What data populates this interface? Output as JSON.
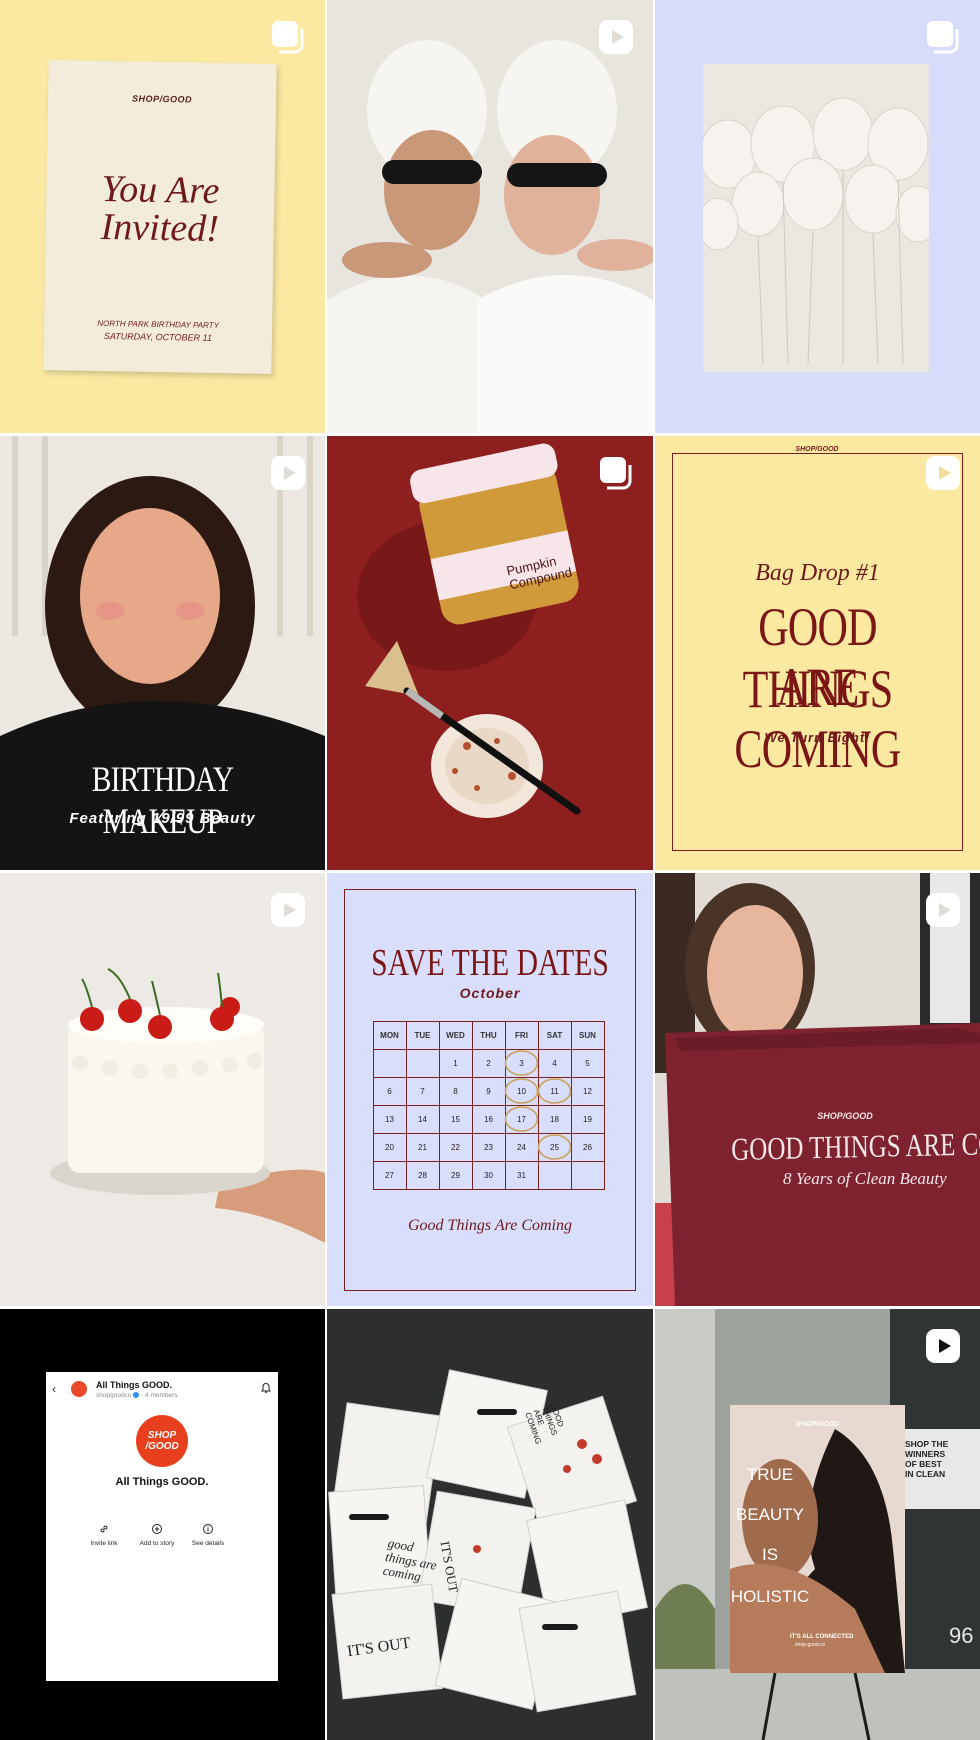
{
  "badges": {
    "carousel": "carousel-icon",
    "reel": "reel-icon"
  },
  "posts": [
    {
      "kind": "invite",
      "brand": "SHOP/GOOD",
      "title_line1": "You Are",
      "title_line2": "Invited!",
      "subtitle_line1": "NORTH PARK BIRTHDAY PARTY",
      "subtitle_line2": "SATURDAY, OCTOBER 11"
    },
    {
      "kind": "photo-towels"
    },
    {
      "kind": "photo-balloons"
    },
    {
      "kind": "birthday-makeup",
      "title": "BIRTHDAY MAKEUP",
      "subtitle": "Featuring 19/99 Beauty"
    },
    {
      "kind": "pumpkin",
      "jar_label_line1": "Pumpkin",
      "jar_label_line2": "Compound",
      "brush_brand": "SHOP/GOOD"
    },
    {
      "kind": "bag-drop",
      "brand": "SHOP/GOOD",
      "script": "Bag Drop #1",
      "line1": "GOOD THINGS",
      "line2": "ARE COMING",
      "footer": "We Turn Eight!"
    },
    {
      "kind": "cake"
    },
    {
      "kind": "calendar",
      "title": "SAVE THE DATES",
      "month": "October",
      "footer": "Good Things Are Coming",
      "days": [
        "MON",
        "TUE",
        "WED",
        "THU",
        "FRI",
        "SAT",
        "SUN"
      ],
      "weeks": [
        [
          "",
          "",
          "1",
          "2",
          "3",
          "4",
          "5"
        ],
        [
          "6",
          "7",
          "8",
          "9",
          "10",
          "11",
          "12"
        ],
        [
          "13",
          "14",
          "15",
          "16",
          "17",
          "18",
          "19"
        ],
        [
          "20",
          "21",
          "22",
          "23",
          "24",
          "25",
          "26"
        ],
        [
          "27",
          "28",
          "29",
          "30",
          "31",
          "",
          ""
        ]
      ],
      "circled": [
        "3",
        "10",
        "11",
        "17",
        "25"
      ]
    },
    {
      "kind": "tote",
      "brand": "SHOP/GOOD",
      "line1": "GOOD THINGS ARE COMI",
      "line2": "8 Years of Clean Beauty"
    },
    {
      "kind": "channel",
      "channel_name": "All Things GOOD.",
      "handle": "shopgoodco",
      "members": "· 4 members",
      "logo_line1": "SHOP",
      "logo_line2": "/GOOD",
      "big_name": "All Things GOOD.",
      "actions": [
        {
          "label": "Invite link",
          "icon": "link-icon"
        },
        {
          "label": "Add to story",
          "icon": "add-story-icon"
        },
        {
          "label": "See details",
          "icon": "info-icon"
        }
      ]
    },
    {
      "kind": "polaroids",
      "snippets": [
        "good things are coming",
        "IT'S OUT",
        "GOOD THINGS ARE COMING",
        "IT'S OUT"
      ]
    },
    {
      "kind": "holistic",
      "brand": "SHOP/GOOD",
      "words": [
        "TRUE",
        "BEAUTY",
        "IS",
        "HOLISTIC"
      ],
      "footer_line1": "IT'S ALL CONNECTED",
      "footer_line2": "shop-good.co",
      "side_sign": [
        "SHOP THE",
        "WINNERS",
        "OF BEST",
        "IN CLEAN"
      ],
      "side_number": "96"
    }
  ]
}
